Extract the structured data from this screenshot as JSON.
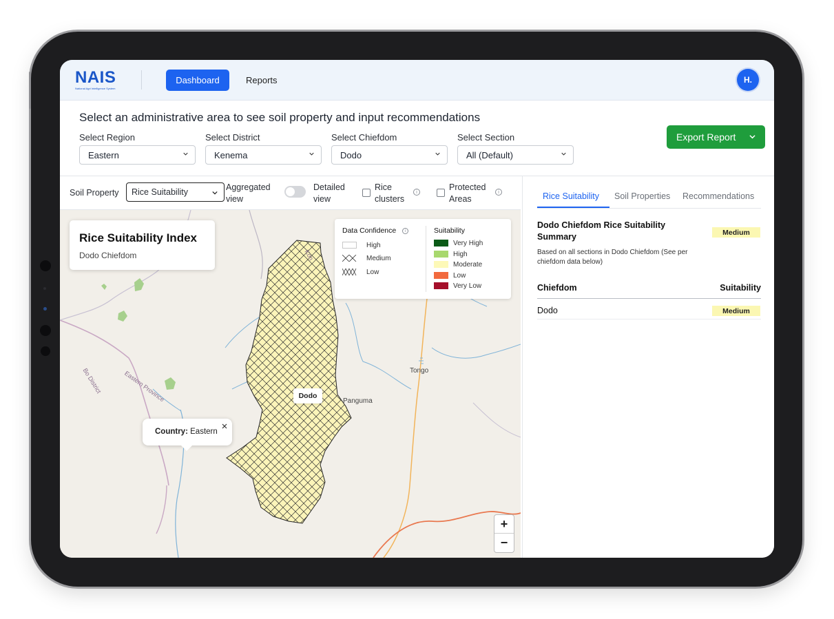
{
  "brand": {
    "logo_text": "NAIS",
    "logo_subtitle": "National Agri Intelligence System"
  },
  "nav": {
    "dashboard_label": "Dashboard",
    "reports_label": "Reports",
    "avatar_initial": "H."
  },
  "filters": {
    "headline": "Select an administrative area to see soil property and input recommendations",
    "region": {
      "label": "Select Region",
      "value": "Eastern"
    },
    "district": {
      "label": "Select District",
      "value": "Kenema"
    },
    "chiefdom": {
      "label": "Select Chiefdom",
      "value": "Dodo"
    },
    "section": {
      "label": "Select Section",
      "value": "All (Default)"
    },
    "export_label": "Export Report"
  },
  "map_controls": {
    "soil_property_label": "Soil Property",
    "soil_property_value": "Rice Suitability",
    "aggregated_view_label_1": "Aggregated",
    "aggregated_view_label_2": "view",
    "detailed_view_label_1": "Detailed",
    "detailed_view_label_2": "view",
    "rice_clusters_label_1": "Rice",
    "rice_clusters_label_2": "clusters",
    "protected_areas_label_1": "Protected",
    "protected_areas_label_2": "Areas"
  },
  "map": {
    "title": "Rice Suitability Index",
    "subtitle": "Dodo Chiefdom",
    "polygon_label": "Dodo",
    "popup_key": "Country:",
    "popup_value": "Eastern",
    "place_labels": {
      "tongo": "Tongo",
      "panguma": "Panguma",
      "bo_district": "Bo District",
      "eastern_province": "Eastern Province",
      "kon": "Kon"
    },
    "zoom_in": "+",
    "zoom_out": "−"
  },
  "legend": {
    "confidence_title": "Data Confidence",
    "confidence_items": [
      "High",
      "Medium",
      "Low"
    ],
    "suitability_title": "Suitability",
    "suitability_items": [
      {
        "label": "Very High",
        "color": "#0b5a17"
      },
      {
        "label": "High",
        "color": "#a8d86e"
      },
      {
        "label": "Moderate",
        "color": "#fdf9b8"
      },
      {
        "label": "Low",
        "color": "#f26a3e"
      },
      {
        "label": "Very Low",
        "color": "#a50f2a"
      }
    ]
  },
  "panel": {
    "tabs": [
      "Rice Suitability",
      "Soil Properties",
      "Recommendations"
    ],
    "summary_title": "Dodo Chiefdom Rice Suitability Summary",
    "summary_badge": "Medium",
    "summary_desc": "Based on all sections in Dodo Chiefdom (See per chiefdom data below)",
    "table_headers": [
      "Chiefdom",
      "Suitability"
    ],
    "rows": [
      {
        "chiefdom": "Dodo",
        "suitability": "Medium"
      }
    ]
  },
  "colors": {
    "primary_blue": "#1d63f0",
    "export_green": "#1f9d3c",
    "medium_badge": "#fbf7b2"
  }
}
